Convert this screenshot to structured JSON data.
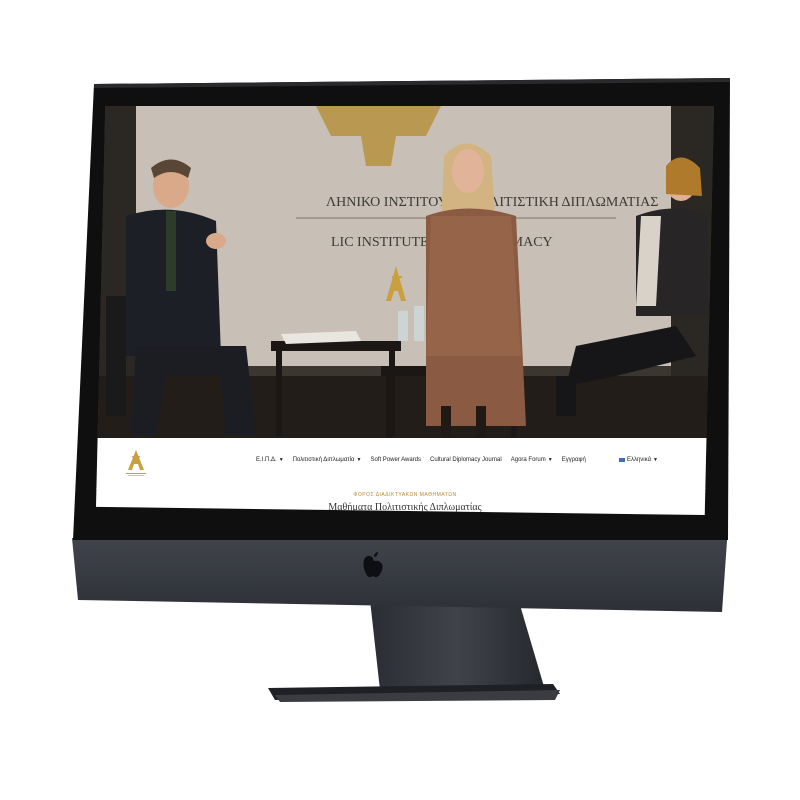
{
  "nav": {
    "items": [
      {
        "label": "Ε.Ι.Π.Δ.",
        "has_dropdown": true
      },
      {
        "label": "Πολιτιστική Διπλωματία",
        "has_dropdown": true
      },
      {
        "label": "Soft Power Awards",
        "has_dropdown": false
      },
      {
        "label": "Cultural Diplomacy Journal",
        "has_dropdown": false
      },
      {
        "label": "Agora Forum",
        "has_dropdown": true
      },
      {
        "label": "Εγγραφή",
        "has_dropdown": false
      }
    ],
    "language": "Ελληνικά"
  },
  "hero": {
    "backdrop_line1": "ΛΗΝΙΚΟ ΙΝΣΤΙΤΟΥΤΟ ΠΟΛΙΤΙΣΤΙΚΗ ΔΙΠΛΩΜΑΤΙΑΣ",
    "backdrop_line2": "LIC INSTITUTE OF CULT LOMACY"
  },
  "section": {
    "eyebrow": "ΦΟΡΟΣ ΔΙΑΔΙΚΤΥΑΚΩΝ ΜΑΘΗΜΑΤΩΝ",
    "headline": "Μαθήματα Πολιτιστικής Διπλωματίας"
  },
  "colors": {
    "gold": "#c9a040",
    "bezel": "#111111",
    "chin": "#3a3d44",
    "stand": "#2c2f36"
  }
}
